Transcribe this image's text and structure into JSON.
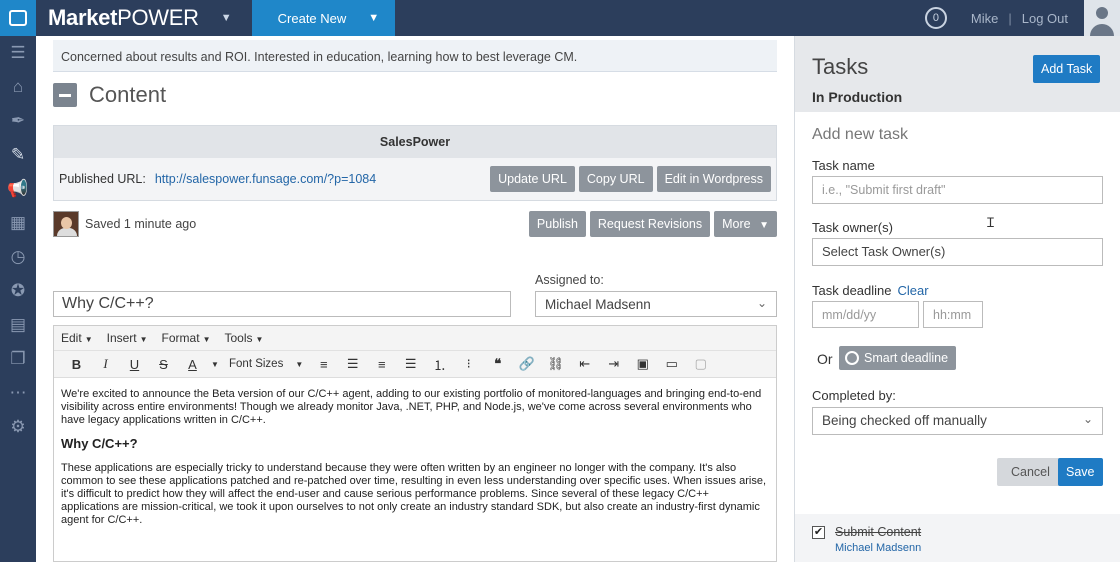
{
  "topbar": {
    "brand_part1": "Market",
    "brand_part2": "POWER",
    "create_new": "Create New",
    "notif_count": "0",
    "user_name": "Mike",
    "separator": "|",
    "logout": "Log Out"
  },
  "sidebar": {
    "icons": [
      "menu-icon",
      "home-icon",
      "pen-nib-icon",
      "pencil-icon",
      "megaphone-icon",
      "calendar-icon",
      "clock-icon",
      "star-icon",
      "report-icon",
      "document-icon",
      "more-icon",
      "gear-icon"
    ]
  },
  "main": {
    "note": "Concerned about results and ROI. Interested in education, learning how to best leverage CM.",
    "section_title": "Content",
    "panel": {
      "title": "SalesPower",
      "published_label": "Published URL:",
      "published_url": "http://salespower.funsage.com/?p=1084",
      "update_url": "Update URL",
      "copy_url": "Copy URL",
      "edit_wordpress": "Edit in Wordpress"
    },
    "saved": {
      "text": "Saved 1 minute ago",
      "publish": "Publish",
      "request_revisions": "Request Revisions",
      "more": "More"
    },
    "title_value": "Why C/C++?",
    "assigned_label": "Assigned to:",
    "assigned_value": "Michael Madsenn",
    "editor": {
      "menu": [
        "Edit",
        "Insert",
        "Format",
        "Tools"
      ],
      "font_sizes": "Font Sizes",
      "para1": "We're excited to announce the Beta version of our C/C++ agent, adding to our existing portfolio of monitored-languages and bringing end-to-end visibility across entire environments! Though we already monitor Java, .NET, PHP, and Node.js, we've come across several environments who have legacy applications written in C/C++.",
      "heading": "Why C/C++?",
      "para2": "These applications are especially tricky to understand because they were often written by an engineer no longer with the company. It's also common to see these applications patched and re-patched over time, resulting in even less understanding over specific uses. When issues arise, it's difficult to predict how they will affect the end-user and cause serious performance problems. Since several of these legacy C/C++ applications are mission-critical, we took it upon ourselves to not only create an industry standard SDK, but also create an industry-first dynamic agent for C/C++."
    }
  },
  "tasks": {
    "title": "Tasks",
    "add_task": "Add Task",
    "subtitle": "In Production",
    "add_new": "Add new task",
    "task_name_label": "Task name",
    "task_name_placeholder": "i.e., \"Submit first draft\"",
    "task_owner_label": "Task owner(s)",
    "task_owner_value": "Select Task Owner(s)",
    "deadline_label": "Task deadline",
    "clear": "Clear",
    "date_placeholder": "mm/dd/yy",
    "time_placeholder": "hh:mm",
    "or": "Or",
    "smart_deadline": "Smart deadline",
    "completed_label": "Completed by:",
    "completed_value": "Being checked off manually",
    "cancel": "Cancel",
    "save": "Save",
    "items": [
      {
        "name": "Submit Content",
        "owner": "Michael Madsenn",
        "done": true
      }
    ]
  }
}
